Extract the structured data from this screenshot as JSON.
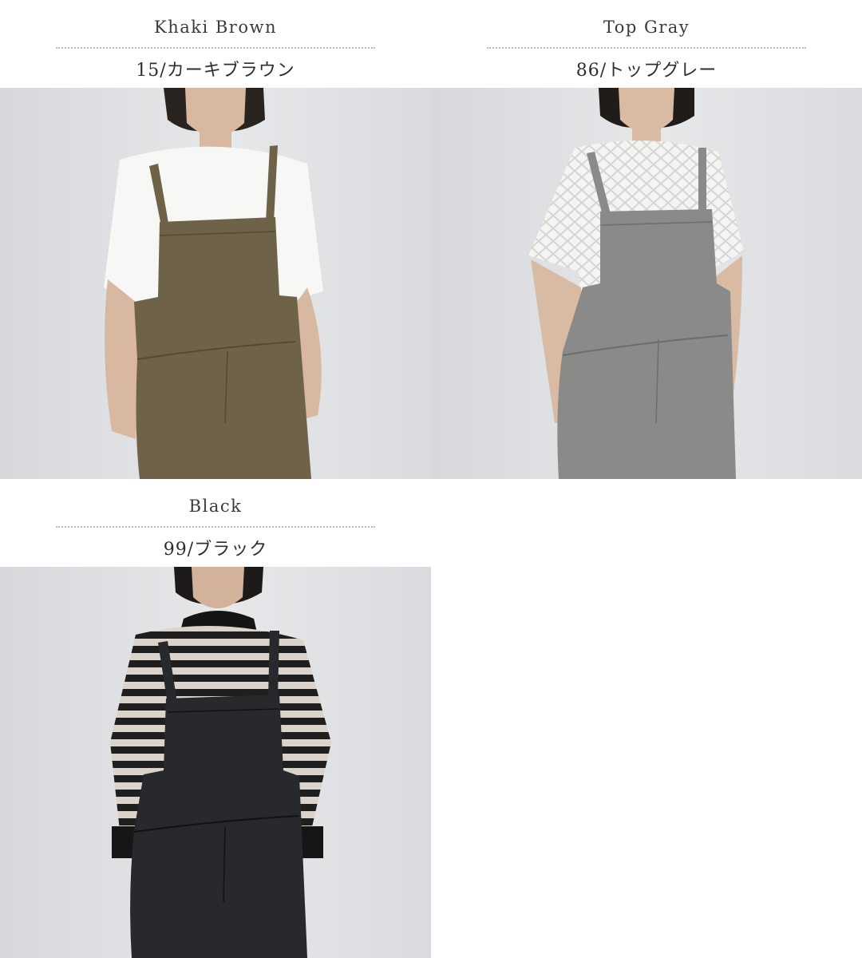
{
  "colors": [
    {
      "en": "Khaki Brown",
      "jp": "15/カーキブラウン",
      "garment_color": "#6e6248",
      "top_color": "#f7f7f5",
      "top_style": "tank",
      "hair": "#2a2420",
      "skin": "#d8b8a0"
    },
    {
      "en": "Top Gray",
      "jp": "86/トップグレー",
      "garment_color": "#8a8a88",
      "top_color": "#f2f2f0",
      "top_style": "lace",
      "hair": "#1f1c1a",
      "skin": "#d9bba3"
    },
    {
      "en": "Black",
      "jp": "99/ブラック",
      "garment_color": "#27292c",
      "top_color": "#d9d3cc",
      "top_style": "stripe",
      "hair": "#1d1b1a",
      "skin": "#d2b29a"
    }
  ],
  "icons": {
    "divider": "dotted-line"
  }
}
